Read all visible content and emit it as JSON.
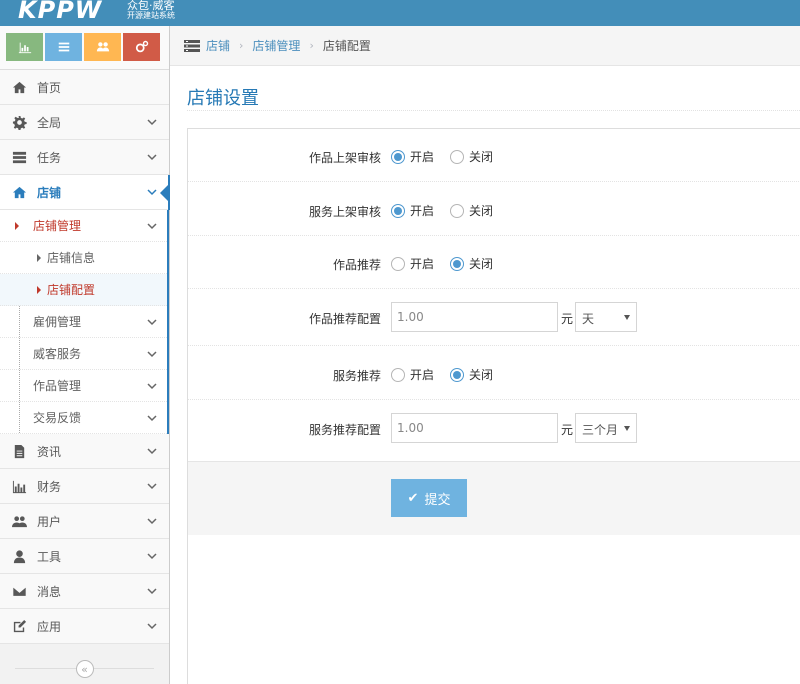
{
  "app": {
    "logo": "KPPW",
    "tagline": "众包·威客",
    "subtagline": "开源建站系统"
  },
  "shortcuts": [
    {
      "icon": "chart-icon",
      "color": "#87b87f"
    },
    {
      "icon": "list-icon",
      "color": "#6fb3e0"
    },
    {
      "icon": "users-icon",
      "color": "#ffb752"
    },
    {
      "icon": "cogs-icon",
      "color": "#d15b47"
    }
  ],
  "sidebar": {
    "items": [
      {
        "label": "首页",
        "icon": "home-icon"
      },
      {
        "label": "全局",
        "icon": "gear-icon"
      },
      {
        "label": "任务",
        "icon": "tasks-icon"
      },
      {
        "label": "店铺",
        "icon": "home-icon"
      }
    ],
    "sub": {
      "shop_manage": "店铺管理",
      "shop_info": "店铺信息",
      "shop_config": "店铺配置",
      "hire_manage": "雇佣管理",
      "witkey_service": "威客服务",
      "work_manage": "作品管理",
      "trade_feedback": "交易反馈"
    },
    "lower_items": [
      {
        "label": "资讯",
        "icon": "file-icon"
      },
      {
        "label": "财务",
        "icon": "bar-chart-icon"
      },
      {
        "label": "用户",
        "icon": "users-icon"
      },
      {
        "label": "工具",
        "icon": "user-icon"
      },
      {
        "label": "消息",
        "icon": "envelope-icon"
      },
      {
        "label": "应用",
        "icon": "edit-icon"
      }
    ],
    "collapse": "«"
  },
  "breadcrumb": {
    "root": "店铺",
    "middle": "店铺管理",
    "current": "店铺配置",
    "sep": "›"
  },
  "page": {
    "title": "店铺设置"
  },
  "form": {
    "work_review": {
      "label": "作品上架审核",
      "on": "开启",
      "off": "关闭",
      "selected": "on"
    },
    "service_review": {
      "label": "服务上架审核",
      "on": "开启",
      "off": "关闭",
      "selected": "on"
    },
    "work_recommend": {
      "label": "作品推荐",
      "on": "开启",
      "off": "关闭",
      "selected": "off"
    },
    "work_recommend_config": {
      "label": "作品推荐配置",
      "value": "1.00",
      "unit": "元",
      "period": "天"
    },
    "service_recommend": {
      "label": "服务推荐",
      "on": "开启",
      "off": "关闭",
      "selected": "off"
    },
    "service_recommend_config": {
      "label": "服务推荐配置",
      "value": "1.00",
      "unit": "元",
      "period": "三个月"
    },
    "submit": "提交"
  },
  "colors": {
    "topbar": "#438eb9",
    "accent": "#2b7dbc",
    "submit": "#6fb3e0"
  }
}
